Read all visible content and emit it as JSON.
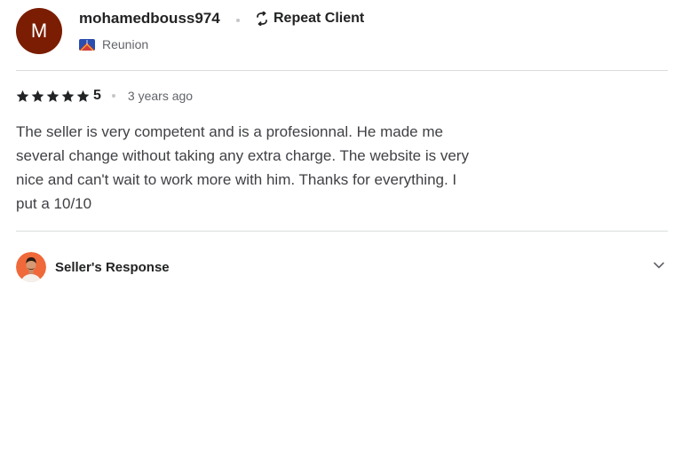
{
  "reviewer": {
    "avatar_initial": "M",
    "avatar_color": "#7a1d02",
    "username": "mohamedbouss974",
    "badge_label": "Repeat Client",
    "badge_icon": "repeat-icon",
    "country": "Reunion",
    "country_flag_icon": "flag-icon"
  },
  "rating": {
    "stars": 5,
    "value": "5",
    "time_ago": "3 years ago"
  },
  "review": {
    "text": "The seller is very competent and is a profesionnal. He made me several change without taking any extra charge. The website is very nice and can't wait to work more with him. Thanks for everything. I put a 10/10"
  },
  "seller_response": {
    "label": "Seller's Response",
    "expand_icon": "chevron-down-icon"
  }
}
